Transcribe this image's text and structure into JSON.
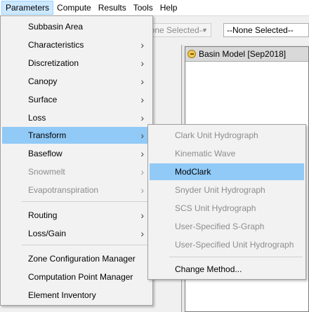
{
  "menubar": {
    "items": [
      "Parameters",
      "Compute",
      "Results",
      "Tools",
      "Help"
    ]
  },
  "toolbar": {
    "combo1": "None Selected--",
    "combo2": "--None Selected--"
  },
  "model_window": {
    "title": "Basin Model [Sep2018]"
  },
  "parameters_menu": {
    "items": [
      {
        "label": "Subbasin Area",
        "submenu": false,
        "enabled": true
      },
      {
        "label": "Characteristics",
        "submenu": true,
        "enabled": true
      },
      {
        "label": "Discretization",
        "submenu": true,
        "enabled": true
      },
      {
        "label": "Canopy",
        "submenu": true,
        "enabled": true
      },
      {
        "label": "Surface",
        "submenu": true,
        "enabled": true
      },
      {
        "label": "Loss",
        "submenu": true,
        "enabled": true
      },
      {
        "label": "Transform",
        "submenu": true,
        "enabled": true,
        "highlighted": true
      },
      {
        "label": "Baseflow",
        "submenu": true,
        "enabled": true
      },
      {
        "label": "Snowmelt",
        "submenu": true,
        "enabled": false
      },
      {
        "label": "Evapotranspiration",
        "submenu": true,
        "enabled": false
      },
      {
        "label": "Routing",
        "submenu": true,
        "enabled": true
      },
      {
        "label": "Loss/Gain",
        "submenu": true,
        "enabled": true
      },
      {
        "label": "Zone Configuration Manager",
        "submenu": false,
        "enabled": true
      },
      {
        "label": "Computation Point Manager",
        "submenu": false,
        "enabled": true
      },
      {
        "label": "Element Inventory",
        "submenu": false,
        "enabled": true
      }
    ],
    "chevron": "›"
  },
  "transform_menu": {
    "items": [
      {
        "label": "Clark Unit Hydrograph",
        "enabled": false
      },
      {
        "label": "Kinematic Wave",
        "enabled": false
      },
      {
        "label": "ModClark",
        "enabled": true,
        "highlighted": true
      },
      {
        "label": "Snyder Unit Hydrograph",
        "enabled": false
      },
      {
        "label": "SCS Unit Hydrograph",
        "enabled": false
      },
      {
        "label": "User-Specified S-Graph",
        "enabled": false
      },
      {
        "label": "User-Specified Unit Hydrograph",
        "enabled": false
      },
      {
        "label": "Change Method...",
        "enabled": true
      }
    ]
  },
  "colors": {
    "highlight": "#91c9f7",
    "disabled_text": "#8d8d8d",
    "menubar_active": "#cce8ff"
  }
}
